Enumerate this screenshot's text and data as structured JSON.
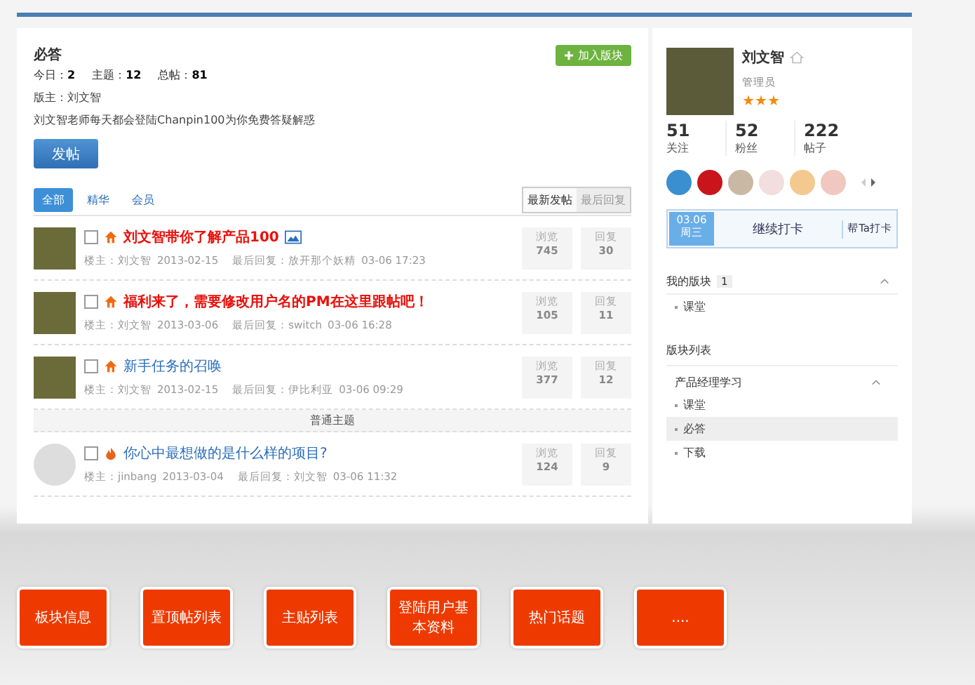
{
  "forum": {
    "title": "必答",
    "stats": [
      {
        "label": "今日：",
        "value": "2"
      },
      {
        "label": "主题：",
        "value": "12"
      },
      {
        "label": "总帖：",
        "value": "81"
      }
    ],
    "moderator": "版主：刘文智",
    "description": "刘文智老师每天都会登陆Chanpin100为你免费答疑解惑",
    "join_button": "加入版块",
    "post_button": "发帖"
  },
  "filter_tabs": [
    {
      "label": "全部",
      "selected": true
    },
    {
      "label": "精华",
      "selected": false
    },
    {
      "label": "会员",
      "selected": false
    }
  ],
  "sort_buttons": [
    {
      "label": "最新发帖",
      "selected": true
    },
    {
      "label": "最后回复",
      "selected": false
    }
  ],
  "threads": [
    {
      "kind": "pinned",
      "title": "刘文智带你了解产品100",
      "highlight": true,
      "has_image": true,
      "checked": false,
      "author": "楼主：刘文智",
      "date": "2013-02-15",
      "last_reply": "最后回复：放开那个妖精",
      "last_time": "03-06 17:23",
      "views_label": "浏览",
      "views": "745",
      "replies_label": "回复",
      "replies": "30"
    },
    {
      "kind": "pinned",
      "title": "福利来了，需要修改用户名的PM在这里跟帖吧！",
      "highlight": true,
      "has_image": false,
      "checked": false,
      "author": "楼主：刘文智",
      "date": "2013-03-06",
      "last_reply": "最后回复：switch",
      "last_time": "03-06 16:28",
      "views_label": "浏览",
      "views": "105",
      "replies_label": "回复",
      "replies": "11"
    },
    {
      "kind": "pinned",
      "title": "新手任务的召唤",
      "highlight": false,
      "has_image": false,
      "checked": false,
      "author": "楼主：刘文智",
      "date": "2013-02-15",
      "last_reply": "最后回复：伊比利亚",
      "last_time": "03-06 09:29",
      "views_label": "浏览",
      "views": "377",
      "replies_label": "回复",
      "replies": "12"
    },
    {
      "kind": "divider",
      "title": "普通主题"
    },
    {
      "kind": "hot",
      "title": "你心中最想做的是什么样的项目?",
      "highlight": false,
      "has_image": false,
      "checked": false,
      "author": "楼主：jinbang",
      "date": "2013-03-04",
      "last_reply": "最后回复：刘文智",
      "last_time": "03-06 11:32",
      "views_label": "浏览",
      "views": "124",
      "replies_label": "回复",
      "replies": "9"
    }
  ],
  "profile": {
    "name": "刘文智",
    "role": "管理员",
    "stars": 3,
    "counts": [
      {
        "value": "51",
        "label": "关注"
      },
      {
        "value": "52",
        "label": "粉丝"
      },
      {
        "value": "222",
        "label": "帖子"
      }
    ],
    "medals": [
      {
        "color": "#3a8fd0"
      },
      {
        "color": "#c8141a"
      },
      {
        "color": "#c9b9a4"
      },
      {
        "color": "#f2dede"
      },
      {
        "color": "#f3c98f"
      },
      {
        "color": "#f0c8c0"
      }
    ],
    "checkin": {
      "date": "03.06",
      "weekday": "周三",
      "action": "继续打卡",
      "help": "帮Ta打卡"
    }
  },
  "my_boards": {
    "title": "我的版块",
    "count": "1",
    "expanded": true,
    "items": [
      "课堂"
    ]
  },
  "board_list": {
    "title": "版块列表",
    "groups": [
      {
        "name": "产品经理学习",
        "expanded": true,
        "items": [
          {
            "label": "课堂",
            "selected": false
          },
          {
            "label": "必答",
            "selected": true
          },
          {
            "label": "下载",
            "selected": false
          }
        ]
      }
    ]
  },
  "modules": [
    "板块信息",
    "置顶帖列表",
    "主贴列表",
    "登陆用户基本资料",
    "热门话题",
    "...."
  ]
}
